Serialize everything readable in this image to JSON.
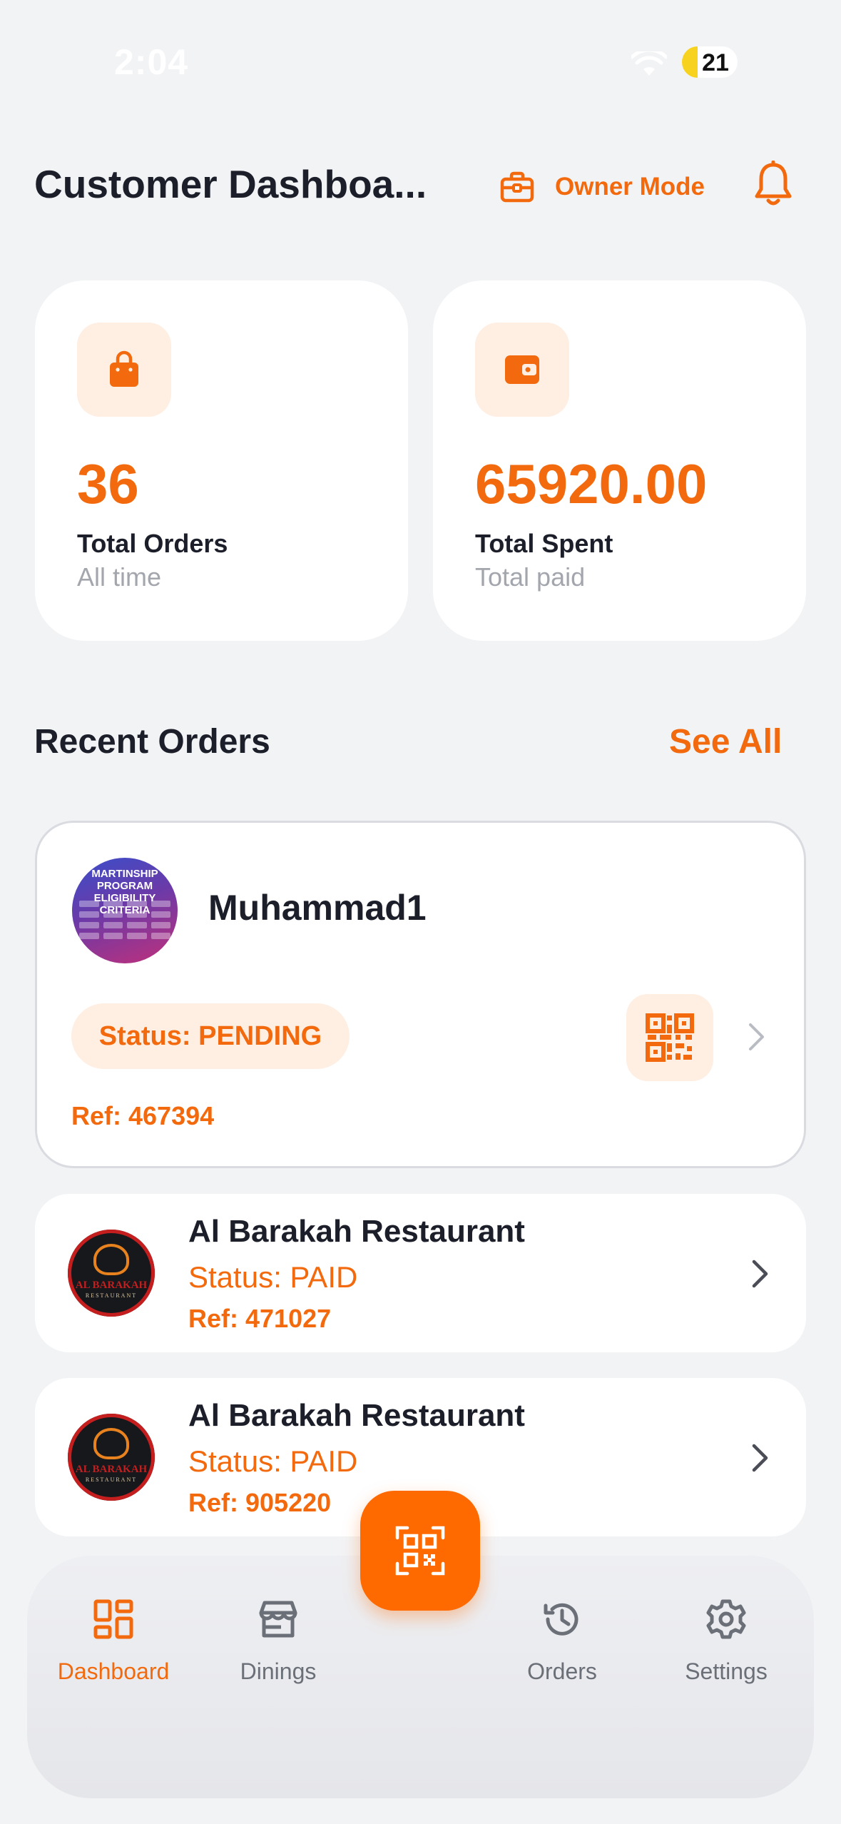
{
  "status_bar": {
    "time": "2:04",
    "battery": "21"
  },
  "header": {
    "title": "Customer Dashboa...",
    "owner_mode_label": "Owner Mode"
  },
  "stats": [
    {
      "icon": "shopping-bag-icon",
      "value": "36",
      "label": "Total Orders",
      "sub": "All time"
    },
    {
      "icon": "wallet-icon",
      "value": "65920.00",
      "label": "Total Spent",
      "sub": "Total paid"
    }
  ],
  "recent_orders": {
    "title": "Recent Orders",
    "see_all": "See All",
    "featured": {
      "name": "Muhammad1",
      "status": "Status: PENDING",
      "ref": "Ref: 467394",
      "avatar_text": "MARTINSHIP PROGRAM ELIGIBILITY CRITERIA"
    },
    "items": [
      {
        "name": "Al Barakah Restaurant",
        "status": "Status: PAID",
        "ref": "Ref: 471027",
        "logo_text": "AL BARAKAH",
        "logo_sub": "RESTAURANT"
      },
      {
        "name": "Al Barakah Restaurant",
        "status": "Status: PAID",
        "ref": "Ref: 905220",
        "logo_text": "AL BARAKAH",
        "logo_sub": "RESTAURANT"
      }
    ]
  },
  "nav": {
    "items": [
      {
        "label": "Dashboard",
        "icon": "dashboard-icon",
        "active": true
      },
      {
        "label": "Dinings",
        "icon": "store-icon",
        "active": false
      },
      {
        "label": "Orders",
        "icon": "history-icon",
        "active": false
      },
      {
        "label": "Settings",
        "icon": "gear-icon",
        "active": false
      }
    ],
    "center_action_icon": "qr-scan-icon"
  },
  "colors": {
    "accent": "#f26a0d",
    "accent_light": "#ffeee2",
    "fab": "#ff6a00",
    "background": "#f2f3f5",
    "text": "#1c1f2a",
    "muted": "#a3a6ad"
  }
}
